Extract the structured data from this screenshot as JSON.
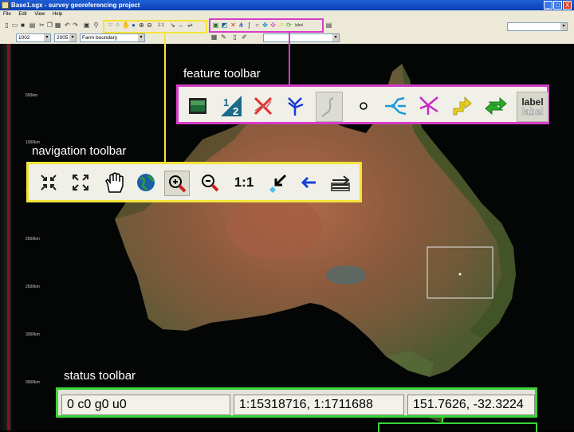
{
  "window": {
    "title": "Base1.sgx - survey georeferencing project",
    "controls": [
      "_",
      "□",
      "X"
    ]
  },
  "menu": [
    "File",
    "Edit",
    "View",
    "Help"
  ],
  "toolbar2": {
    "combo1": "1002",
    "combo2": "2005",
    "combo3": "Farm boundary"
  },
  "map": {
    "scale_labels": [
      "500km",
      "1000km",
      "1500km",
      "2000km",
      "2500km",
      "3000km",
      "3500km"
    ]
  },
  "callouts": {
    "feature_label": "feature toolbar",
    "navigation_label": "navigation toolbar",
    "status_label": "status toolbar"
  },
  "feature_toolbar": {
    "icons": [
      "image-layer-icon",
      "scale-half-icon",
      "delete-feature-icon",
      "branch-tree-icon",
      "select-feature-icon",
      "circle-point-icon",
      "network-icon",
      "pink-network-icon",
      "yellow-arrow-icon",
      "green-refresh-icon",
      "label-icon"
    ],
    "label_text": "label"
  },
  "navigation_toolbar": {
    "one_to_one": "1:1"
  },
  "status_toolbar": {
    "cell1": "0 c0 g0 u0",
    "cell2": "1:15318716, 1:1711688",
    "cell3": "151.7626, -32.3224"
  },
  "colors": {
    "feature_highlight": "#d63cc8",
    "navigation_highlight": "#f3e43a",
    "status_highlight": "#39d639",
    "titlebar": "#0a3fb3"
  }
}
